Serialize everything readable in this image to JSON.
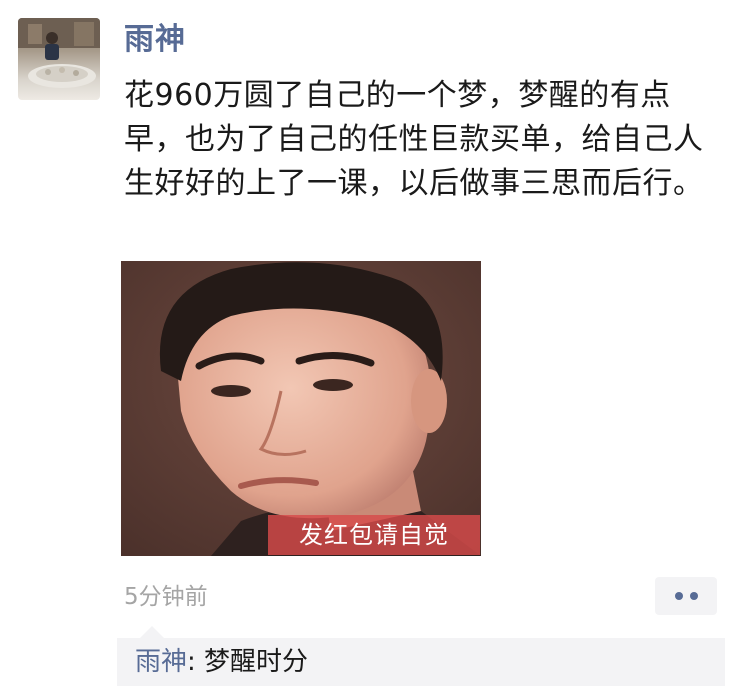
{
  "post": {
    "author": "雨神",
    "text": "花960万圆了自己的一个梦，梦醒的有点早，也为了自己的任性巨款买单，给自己人生好好的上了一课，以后做事三思而后行。",
    "image_watermark": "发红包请自觉",
    "timestamp": "5分钟前"
  },
  "comments": [
    {
      "author": "雨神",
      "separator": ": ",
      "text": "梦醒时分"
    }
  ],
  "colors": {
    "link": "#576b95",
    "text": "#1a1a1a",
    "muted": "#a5a5a5",
    "comment_bg": "#f3f3f5",
    "watermark_bg": "#d74b4b"
  },
  "icons": {
    "more": "two-dots-icon"
  }
}
